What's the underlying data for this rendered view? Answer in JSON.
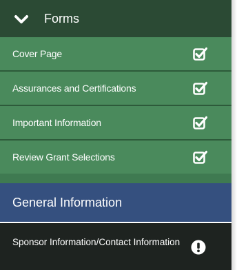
{
  "forms_section": {
    "title": "Forms",
    "expanded_icon": "chevron-down-icon",
    "items": [
      {
        "label": "Cover Page",
        "status_icon": "check-square-icon"
      },
      {
        "label": "Assurances and Certifications",
        "status_icon": "check-square-icon"
      },
      {
        "label": "Important Information",
        "status_icon": "check-square-icon"
      },
      {
        "label": "Review Grant Selections",
        "status_icon": "check-square-icon"
      }
    ]
  },
  "general_section": {
    "title": "General Information",
    "items": [
      {
        "label": "Sponsor Information/Contact Information",
        "status_icon": "exclamation-circle-icon"
      }
    ]
  },
  "colors": {
    "forms_header_bg": "#2b4a34",
    "form_item_bg": "#4a8a5c",
    "general_header_bg": "#35507f",
    "active_item_bg": "#1e2320",
    "text": "#ffffff"
  }
}
